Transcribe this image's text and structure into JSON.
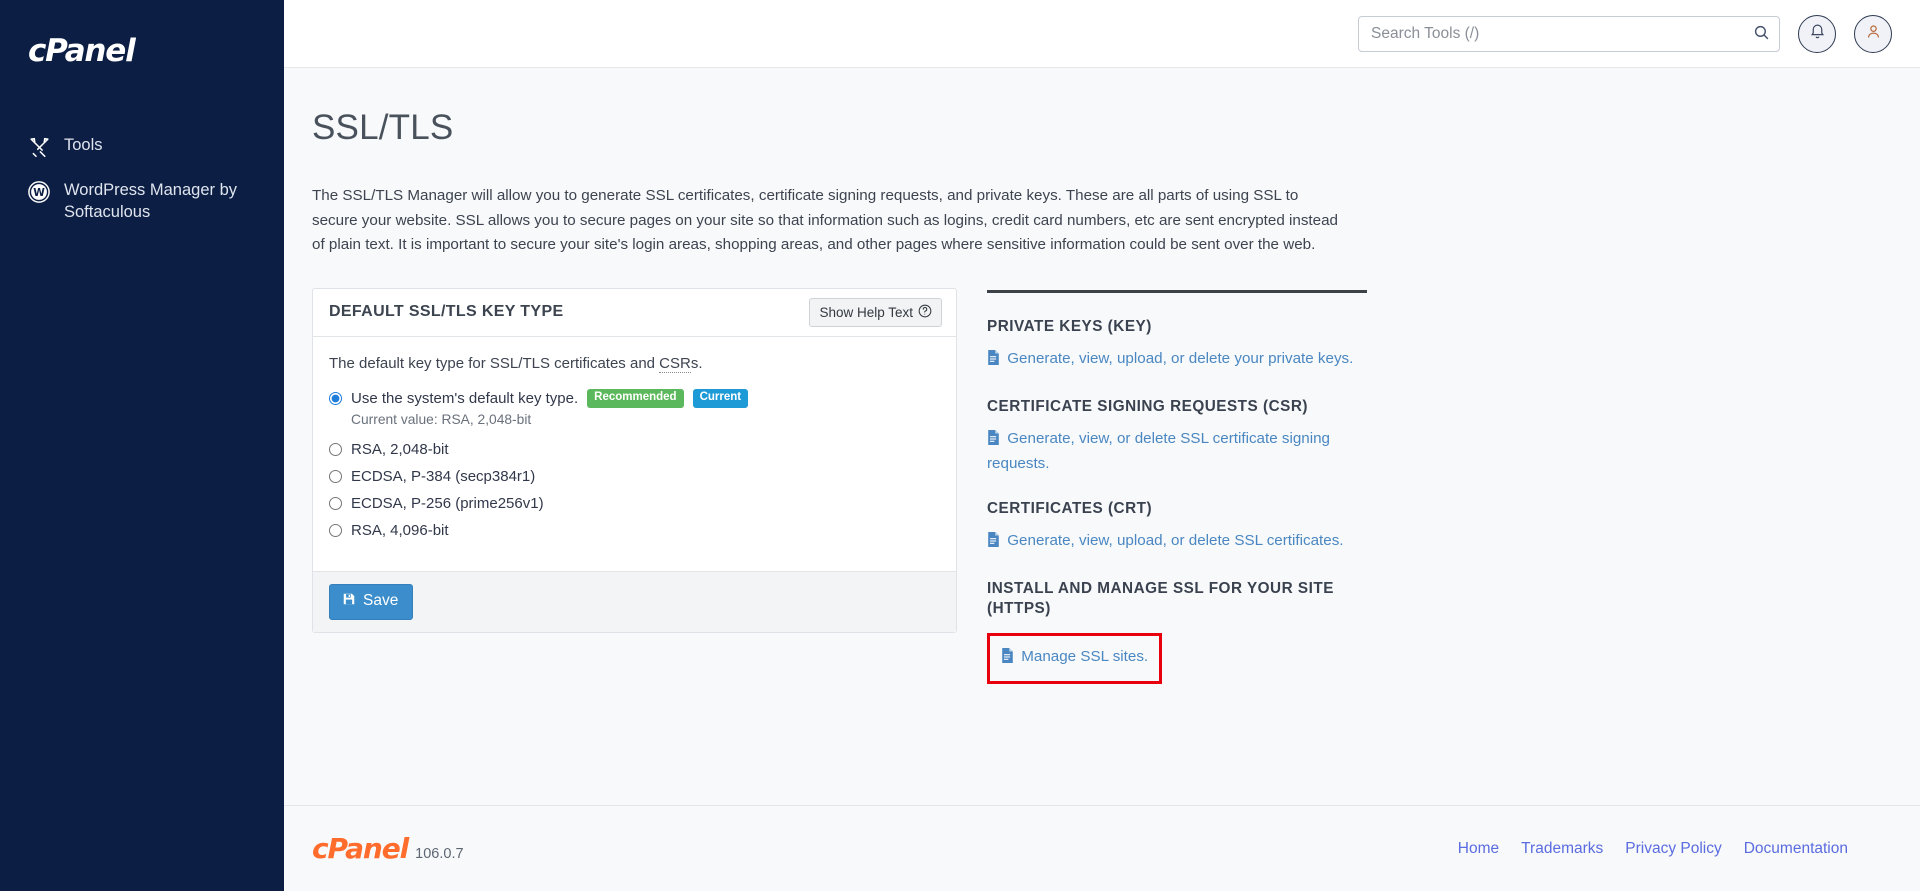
{
  "sidebar": {
    "brand": "cPanel",
    "items": [
      {
        "label": "Tools",
        "icon": "tools-icon"
      },
      {
        "label": "WordPress Manager by Softaculous",
        "icon": "wordpress-icon"
      }
    ]
  },
  "topbar": {
    "search_placeholder": "Search Tools (/)",
    "search_value": "",
    "search_icon": "search-icon",
    "notifications_icon": "bell-icon",
    "account_icon": "user-icon"
  },
  "page": {
    "title": "SSL/TLS",
    "intro": "The SSL/TLS Manager will allow you to generate SSL certificates, certificate signing requests, and private keys. These are all parts of using SSL to secure your website. SSL allows you to secure pages on your site so that information such as logins, credit card numbers, etc are sent encrypted instead of plain text. It is important to secure your site's login areas, shopping areas, and other pages where sensitive information could be sent over the web."
  },
  "card": {
    "title": "DEFAULT SSL/TLS KEY TYPE",
    "help_label": "Show Help Text",
    "help_icon": "question-circle-icon",
    "lead_prefix": "The default key type for SSL/TLS certificates and ",
    "lead_abbr": "CSR",
    "lead_suffix": "s.",
    "options": [
      {
        "label": "Use the system's default key type.",
        "selected": true,
        "badges": [
          {
            "text": "Recommended",
            "color": "#5cb85c"
          },
          {
            "text": "Current",
            "color": "#1e9ad6"
          }
        ],
        "note": "Current value: RSA, 2,048-bit"
      },
      {
        "label": "RSA, 2,048-bit",
        "selected": false
      },
      {
        "label": "ECDSA, P-384 (secp384r1)",
        "selected": false
      },
      {
        "label": "ECDSA, P-256 (prime256v1)",
        "selected": false
      },
      {
        "label": "RSA, 4,096-bit",
        "selected": false
      }
    ],
    "save_label": "Save",
    "save_icon": "floppy-disk-icon"
  },
  "side_panel": {
    "sections": [
      {
        "heading": "PRIVATE KEYS (KEY)",
        "link": "Generate, view, upload, or delete your private keys.",
        "icon": "document-icon",
        "highlighted": false
      },
      {
        "heading": "CERTIFICATE SIGNING REQUESTS (CSR)",
        "link": "Generate, view, or delete SSL certificate signing requests.",
        "icon": "document-icon",
        "highlighted": false
      },
      {
        "heading": "CERTIFICATES (CRT)",
        "link": "Generate, view, upload, or delete SSL certificates.",
        "icon": "document-icon",
        "highlighted": false
      },
      {
        "heading": "INSTALL AND MANAGE SSL FOR YOUR SITE (HTTPS)",
        "link": "Manage SSL sites.",
        "icon": "document-icon",
        "highlighted": true
      }
    ]
  },
  "footer": {
    "brand": "cPanel",
    "version": "106.0.7",
    "links": [
      "Home",
      "Trademarks",
      "Privacy Policy",
      "Documentation"
    ]
  },
  "colors": {
    "sidebar_bg": "#0c1e43",
    "accent_blue": "#3c8dcb",
    "link_blue": "#4a87c2",
    "badge_green": "#5cb85c",
    "badge_blue": "#1e9ad6",
    "highlight_red": "#e8000d",
    "logo_orange": "#ff6c2c",
    "footer_link": "#5b6ce0"
  }
}
